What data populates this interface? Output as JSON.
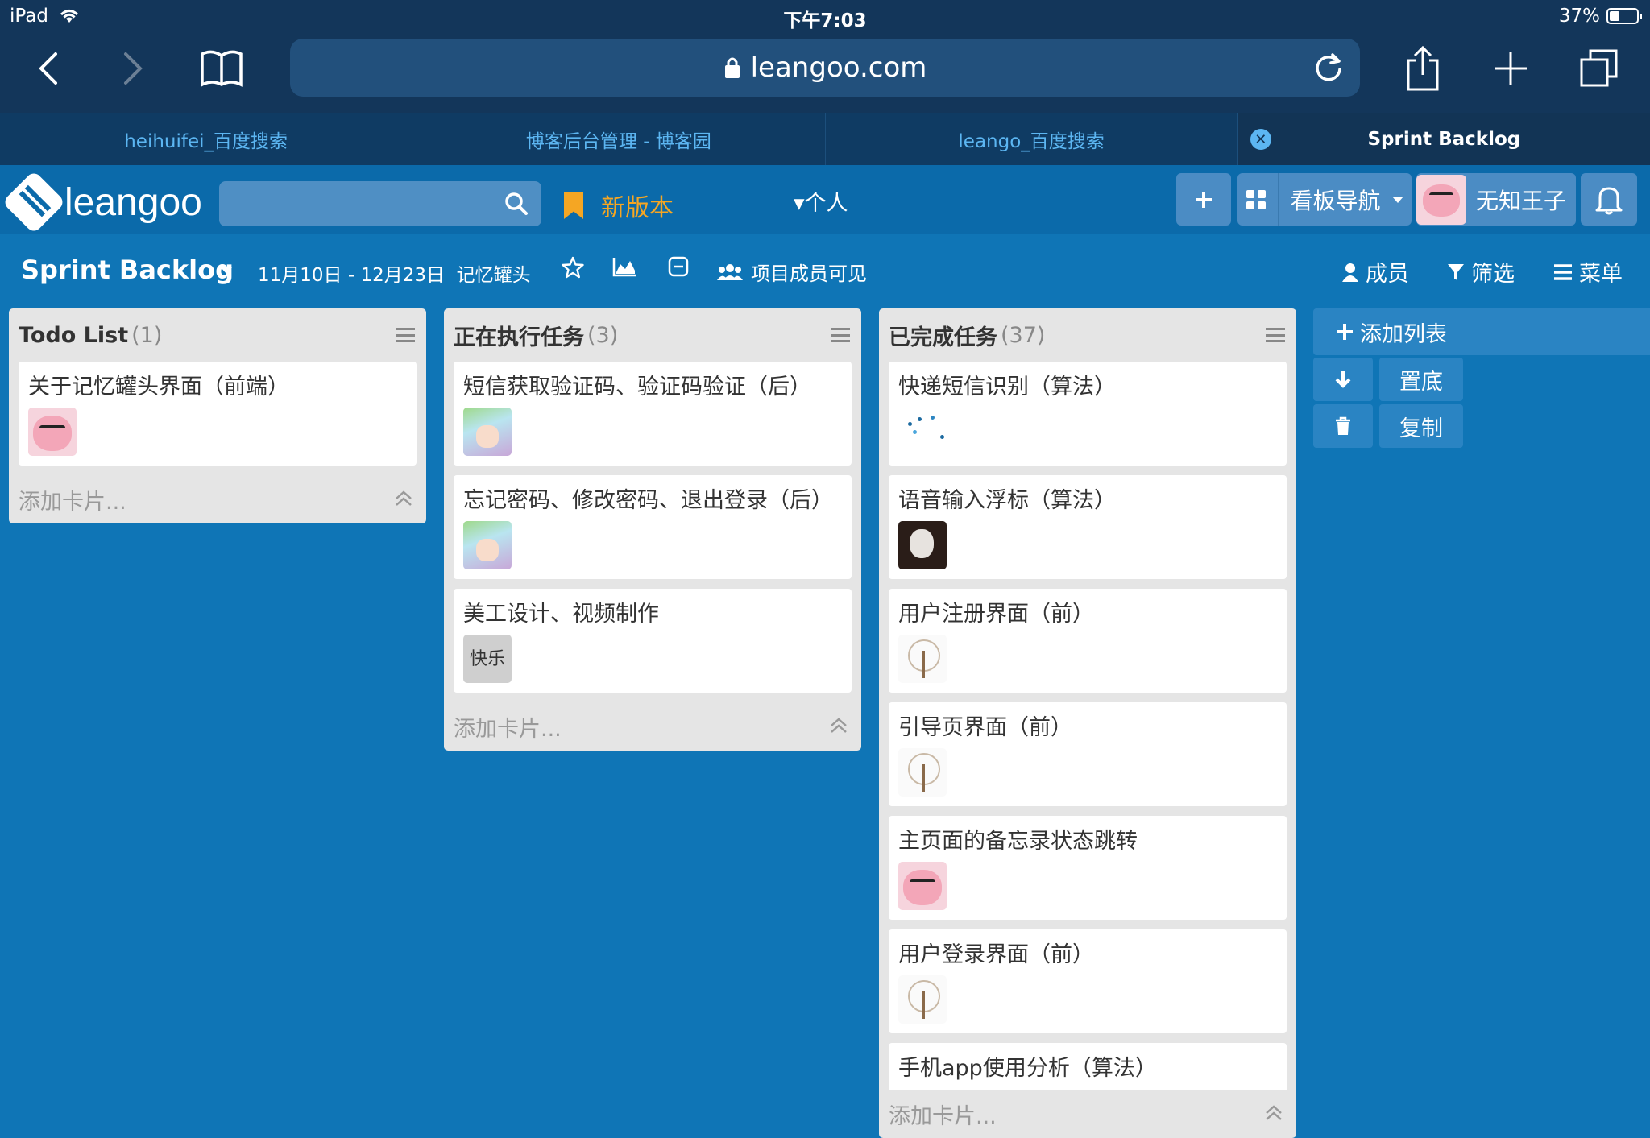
{
  "status": {
    "device": "iPad",
    "time": "下午7:03",
    "battery": "37%",
    "battery_level": 0.37
  },
  "browser": {
    "url": "leangoo.com",
    "tabs": [
      {
        "label": "heihuifei_百度搜索"
      },
      {
        "label": "博客后台管理 - 博客园"
      },
      {
        "label": "leango_百度搜索"
      },
      {
        "label": "Sprint Backlog"
      }
    ]
  },
  "app": {
    "logo_text": "leangoo",
    "search_placeholder": "",
    "new_version": "新版本",
    "personal": "▾个人",
    "board_nav": "看板导航",
    "user_name": "无知王子"
  },
  "board": {
    "title": "Sprint Backlog",
    "dates": "11月10日 - 12月23日",
    "project": "记忆罐头",
    "visibility": "项目成员可见",
    "members": "成员",
    "filter": "筛选",
    "menu": "菜单"
  },
  "lists": [
    {
      "title": "Todo List",
      "count": "(1)",
      "cards": [
        {
          "text": "关于记忆罐头界面（前端）",
          "member": "pig"
        }
      ],
      "add_card": "添加卡片..."
    },
    {
      "title": "正在执行任务",
      "count": "(3)",
      "cards": [
        {
          "text": "短信获取验证码、验证码验证（后）",
          "member": "anime"
        },
        {
          "text": "忘记密码、修改密码、退出登录（后）",
          "member": "anime"
        },
        {
          "text": "美工设计、视频制作",
          "member": "tag",
          "tag": "快乐"
        }
      ],
      "add_card": "添加卡片..."
    },
    {
      "title": "已完成任务",
      "count": "(37)",
      "cards": [
        {
          "text": "快递短信识别（算法）",
          "member": "dots"
        },
        {
          "text": "语音输入浮标（算法）",
          "member": "cat"
        },
        {
          "text": "用户注册界面（前）",
          "member": "umbrella"
        },
        {
          "text": "引导页界面（前）",
          "member": "umbrella"
        },
        {
          "text": "主页面的备忘录状态跳转",
          "member": "pig"
        },
        {
          "text": "用户登录界面（前）",
          "member": "umbrella"
        },
        {
          "text": "手机app使用分析（算法）",
          "member": ""
        }
      ],
      "add_card": "添加卡片..."
    }
  ],
  "side": {
    "add_list": "添加列表",
    "bottom": "置底",
    "copy": "复制"
  }
}
